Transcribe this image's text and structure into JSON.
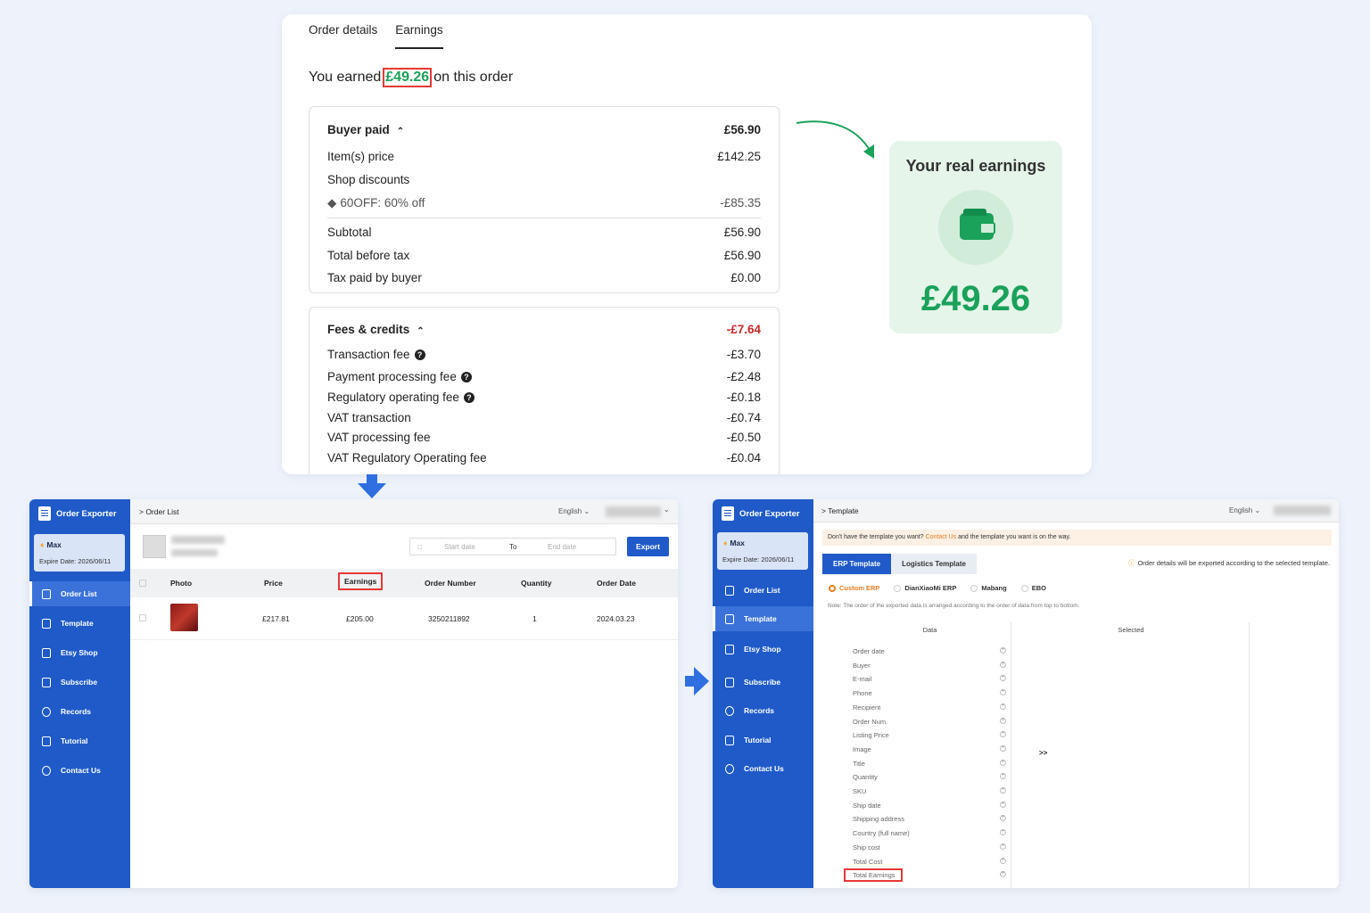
{
  "earnings_card": {
    "tabs": [
      "Order details",
      "Earnings"
    ],
    "earned_prefix": "You earned",
    "earned_amount": "£49.26",
    "earned_suffix": "on this order",
    "buyer_paid": {
      "title": "Buyer paid",
      "total": "£56.90",
      "rows": [
        {
          "label": "Item(s) price",
          "value": "£142.25"
        },
        {
          "label": "Shop discounts",
          "value": ""
        },
        {
          "label": "60OFF: 60% off",
          "value": "-£85.35"
        },
        {
          "label": "Subtotal",
          "value": "£56.90"
        },
        {
          "label": "Total before tax",
          "value": "£56.90"
        },
        {
          "label": "Tax paid by buyer",
          "value": "£0.00"
        }
      ]
    },
    "fees": {
      "title": "Fees & credits",
      "total": "-£7.64",
      "rows": [
        {
          "label": "Transaction fee",
          "value": "-£3.70"
        },
        {
          "label": "Payment processing fee",
          "value": "-£2.48"
        },
        {
          "label": "Regulatory operating fee",
          "value": "-£0.18"
        },
        {
          "label": "VAT transaction",
          "value": "-£0.74"
        },
        {
          "label": "VAT processing fee",
          "value": "-£0.50"
        },
        {
          "label": "VAT Regulatory Operating fee",
          "value": "-£0.04"
        }
      ]
    }
  },
  "real_earnings": {
    "title": "Your real earnings",
    "amount": "£49.26"
  },
  "sidebar": {
    "app_name": "Order Exporter",
    "user_name": "Max",
    "expire": "Expire Date: 2026/06/11",
    "items": [
      "Order List",
      "Template",
      "Etsy Shop",
      "Subscribe",
      "Records",
      "Tutorial",
      "Contact Us"
    ]
  },
  "order_list": {
    "breadcrumb": "> Order List",
    "language": "English",
    "start_placeholder": "Start date",
    "to": "To",
    "end_placeholder": "End date",
    "export": "Export",
    "columns": [
      "Photo",
      "Price",
      "Earnings",
      "Order Number",
      "Quantity",
      "Order Date"
    ],
    "row": {
      "price": "£217.81",
      "earnings": "£205.00",
      "order_number": "3250211892",
      "quantity": "1",
      "date": "2024.03.23"
    }
  },
  "template": {
    "breadcrumb": "> Template",
    "language": "English",
    "notice_a": "Don't have the template you want?",
    "notice_link": "Contact Us",
    "notice_b": "and the template you want is on the way.",
    "tabs": [
      "ERP Template",
      "Logistics Template"
    ],
    "tip": "Order details will be exported according to the selected template.",
    "radios": [
      "Custom ERP",
      "DianXiaoMi ERP",
      "Mabang",
      "EBO"
    ],
    "note": "Note: The order of the exported data is arranged according to the order of data from top to bottom.",
    "data_header": "Data",
    "selected_header": "Selected",
    "move": ">>",
    "fields": [
      "Order date",
      "Buyer",
      "E-mail",
      "Phone",
      "Recipient",
      "Order Num.",
      "Listing Price",
      "Image",
      "Title",
      "Quantity",
      "SKU",
      "Ship date",
      "Shipping address",
      "Country (full name)",
      "Ship cost",
      "Total Cost",
      "Total Earnings"
    ]
  },
  "colors": {
    "accent_blue": "#1f5ac8",
    "earn_green": "#1aa15a",
    "highlight_red": "#e53935"
  }
}
